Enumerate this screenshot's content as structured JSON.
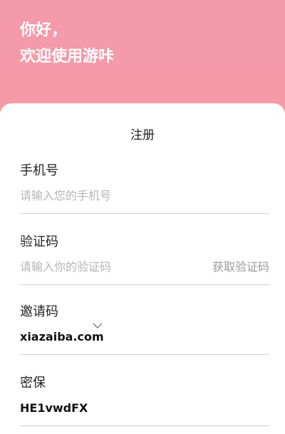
{
  "header": {
    "greeting_line1": "你好，",
    "greeting_line2": "欢迎使用游咔"
  },
  "form": {
    "title": "注册",
    "phone": {
      "label": "手机号",
      "placeholder": "请输入您的手机号"
    },
    "code": {
      "label": "验证码",
      "placeholder": "请输入你的验证码",
      "action_label": "获取验证码"
    },
    "invite": {
      "label": "邀请码",
      "value": "xiazaiba.com"
    },
    "security": {
      "label": "密保",
      "value": "HE1vwdFX"
    }
  },
  "colors": {
    "header_gradient_top": "#f49aab",
    "header_gradient_bottom": "#fd9b9d",
    "placeholder": "#b5b5b5",
    "divider": "#cfcfcf"
  },
  "icons": {
    "invite_dropdown": "chevron-down-icon"
  }
}
